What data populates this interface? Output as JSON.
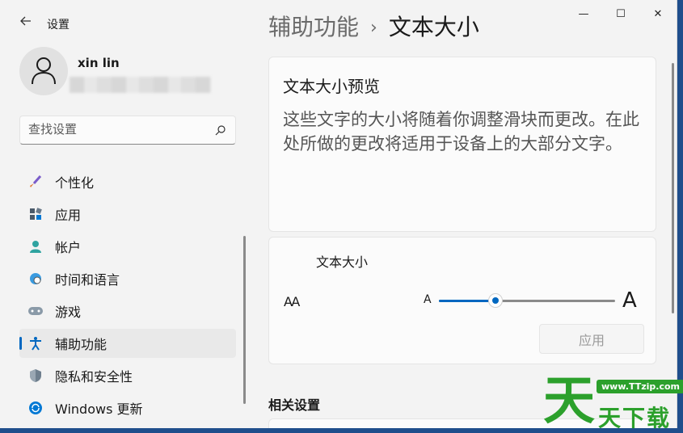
{
  "app": {
    "title": "设置",
    "back_icon": "back-arrow-icon"
  },
  "window_controls": {
    "minimize": "—",
    "maximize": "☐",
    "close": "✕"
  },
  "user": {
    "name": "xin lin",
    "email": ""
  },
  "search": {
    "placeholder": "查找设置"
  },
  "sidebar": {
    "items": [
      {
        "label": "个性化",
        "icon": "brush-icon",
        "active": false
      },
      {
        "label": "应用",
        "icon": "apps-icon",
        "active": false
      },
      {
        "label": "帐户",
        "icon": "account-icon",
        "active": false
      },
      {
        "label": "时间和语言",
        "icon": "globe-clock-icon",
        "active": false
      },
      {
        "label": "游戏",
        "icon": "gamepad-icon",
        "active": false
      },
      {
        "label": "辅助功能",
        "icon": "accessibility-icon",
        "active": true
      },
      {
        "label": "隐私和安全性",
        "icon": "shield-icon",
        "active": false
      },
      {
        "label": "Windows 更新",
        "icon": "update-icon",
        "active": false
      }
    ]
  },
  "breadcrumb": {
    "parent": "辅助功能",
    "separator": "›",
    "current": "文本大小"
  },
  "preview": {
    "title": "文本大小预览",
    "body": "这些文字的大小将随着你调整滑块而更改。在此处所做的更改将适用于设备上的大部分文字。"
  },
  "text_size": {
    "label": "文本大小",
    "icon": "text-size-icon",
    "icon_text": "AA",
    "min_label": "A",
    "max_label": "A",
    "slider_fraction": 0.32,
    "apply_label": "应用"
  },
  "related": {
    "title": "相关设置"
  },
  "watermark": {
    "main": "天",
    "url": "www.TTzip.com",
    "sub": "天下载"
  },
  "colors": {
    "accent": "#0067c0",
    "watermark": "#2ca02c"
  }
}
